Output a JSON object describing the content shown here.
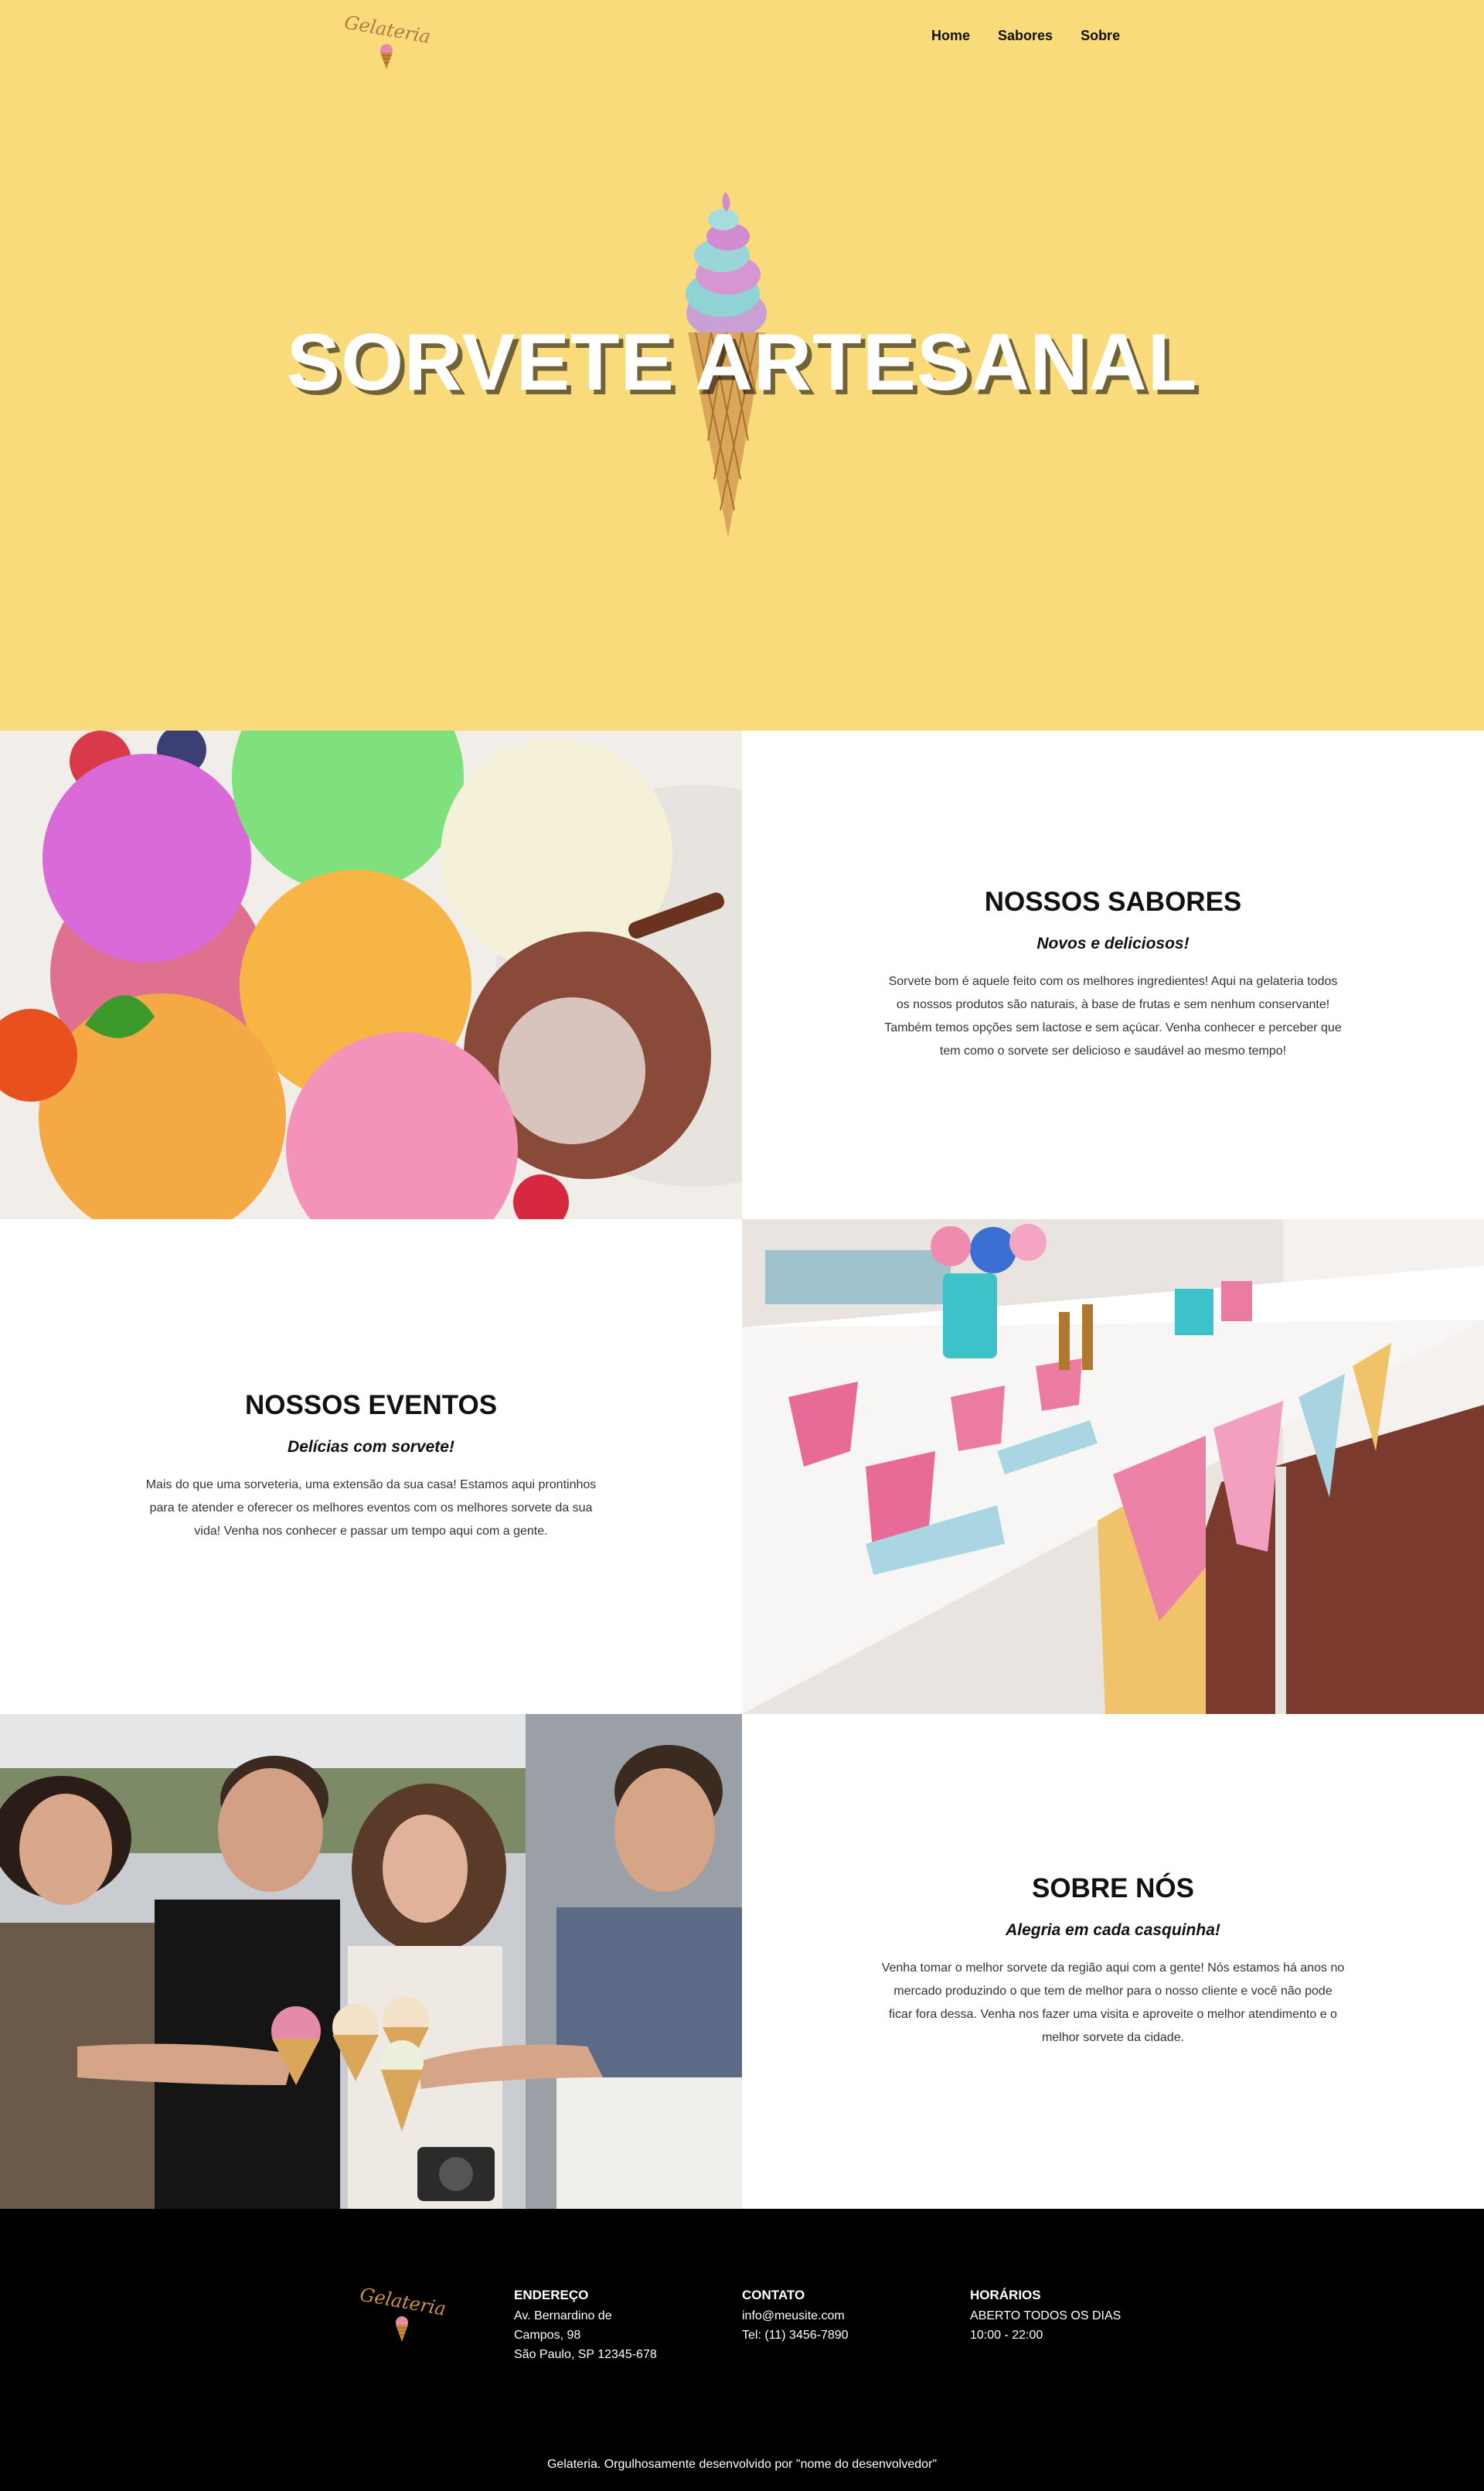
{
  "header": {
    "logo_text": "Gelateria",
    "nav": [
      {
        "label": "Home"
      },
      {
        "label": "Sabores"
      },
      {
        "label": "Sobre"
      }
    ]
  },
  "hero": {
    "title": "SORVETE ARTESANAL"
  },
  "sections": [
    {
      "title": "NOSSOS SABORES",
      "subtitle": "Novos e deliciosos!",
      "body": "Sorvete bom é aquele feito com os melhores ingredientes! Aqui na gelateria todos os nossos produtos são naturais, à base de frutas e sem nenhum conservante! Também temos opções sem lactose e sem açúcar. Venha conhecer e perceber que tem como o sorvete ser delicioso e saudável ao mesmo tempo!"
    },
    {
      "title": "NOSSOS EVENTOS",
      "subtitle": "Delícias com sorvete!",
      "body": "Mais do que uma sorveteria, uma extensão da sua casa! Estamos aqui prontinhos para te atender e oferecer os melhores eventos com os melhores sorvete da sua vida! Venha nos conhecer e passar um tempo aqui com a gente."
    },
    {
      "title": "SOBRE NÓS",
      "subtitle": "Alegria em cada casquinha!",
      "body": "Venha tomar o melhor sorvete da região aqui com a gente! Nós estamos há anos no mercado produzindo o que tem de melhor para o nosso cliente e você não pode ficar fora dessa. Venha nos fazer uma visita e aproveite o melhor atendimento e o melhor sorvete da cidade."
    }
  ],
  "footer": {
    "logo_text": "Gelateria",
    "address": {
      "title": "ENDEREÇO",
      "line1": "Av. Bernardino de",
      "line2": "Campos, 98",
      "line3": "São Paulo, SP 12345-678"
    },
    "contact": {
      "title": "CONTATO",
      "email": "info@meusite.com",
      "phone": "Tel: (11) 3456-7890"
    },
    "hours": {
      "title": "HORÁRIOS",
      "line1": "ABERTO TODOS OS DIAS",
      "line2": "10:00 - 22:00"
    },
    "credit": "Gelateria. Orgulhosamente desenvolvido por \"nome do desenvolvedor\""
  },
  "colors": {
    "hero_bg": "#FADB7C",
    "footer_bg": "#000000",
    "logo_brown": "#b07a3a"
  },
  "icons": [
    "ice-cream-cone-icon"
  ]
}
